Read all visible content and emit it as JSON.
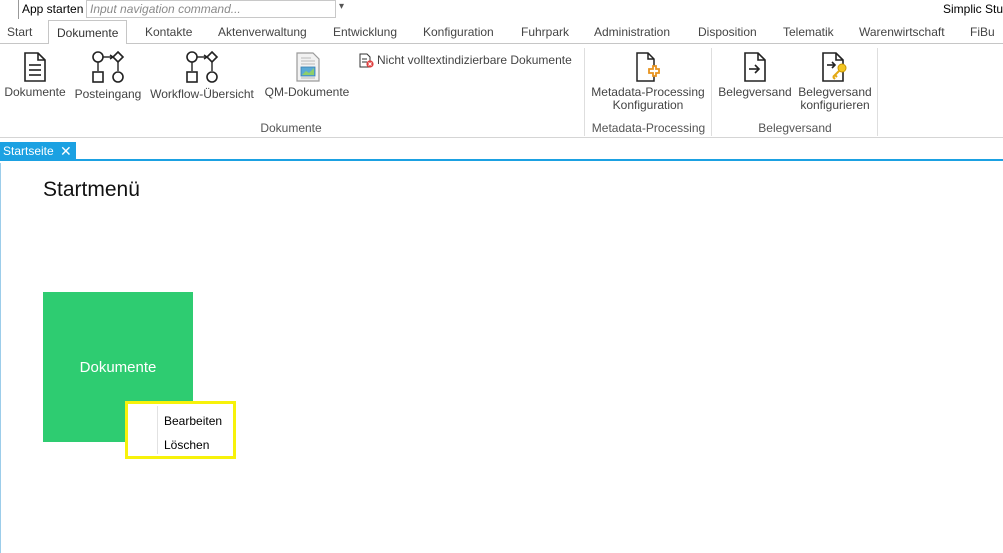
{
  "topbar": {
    "app_start": "App starten",
    "nav_placeholder": "Input navigation command...",
    "dropdown_glyph": "▾",
    "brand": "Simplic Stu"
  },
  "tabs": [
    {
      "label": "Start"
    },
    {
      "label": "Dokumente",
      "active": true
    },
    {
      "label": "Kontakte"
    },
    {
      "label": "Aktenverwaltung"
    },
    {
      "label": "Entwicklung"
    },
    {
      "label": "Konfiguration"
    },
    {
      "label": "Fuhrpark"
    },
    {
      "label": "Administration"
    },
    {
      "label": "Disposition"
    },
    {
      "label": "Telematik"
    },
    {
      "label": "Warenwirtschaft"
    },
    {
      "label": "FiBu"
    }
  ],
  "ribbon": {
    "dokumente_group": {
      "label": "Dokumente",
      "buttons": {
        "dokumente": "Dokumente",
        "posteingang": "Posteingang",
        "workflow": "Workflow-Übersicht",
        "qm": "QM-Dokumente"
      },
      "small_button": "Nicht volltextindizierbare Dokumente"
    },
    "metadata_group": {
      "label": "Metadata-Processing",
      "button_line1": "Metadata-Processing",
      "button_line2": "Konfiguration"
    },
    "belegversand_group": {
      "label": "Belegversand",
      "belegversand": "Belegversand",
      "konfig_line1": "Belegversand",
      "konfig_line2": "konfigurieren"
    }
  },
  "doc_tab": {
    "label": "Startseite",
    "close_glyph": "✕"
  },
  "content": {
    "title": "Startmenü",
    "tile": {
      "label": "Dokumente",
      "color": "#2ecc71"
    },
    "context_menu": {
      "items": [
        "Bearbeiten",
        "Löschen"
      ],
      "highlight_color": "#f7f20a"
    }
  },
  "colors": {
    "accent": "#1ba1e2",
    "tile": "#2ecc71",
    "highlight": "#f7f20a"
  }
}
